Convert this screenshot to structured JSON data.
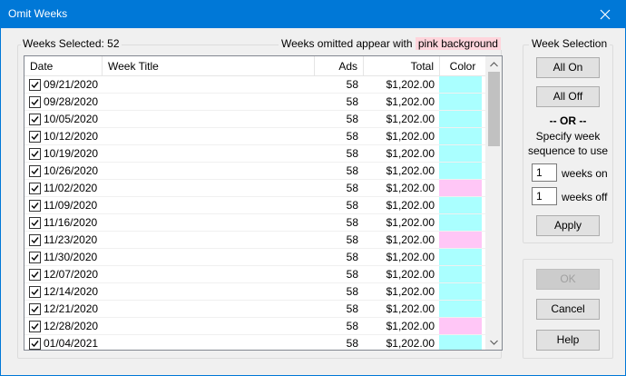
{
  "window": {
    "title": "Omit Weeks"
  },
  "summary": {
    "weeks_selected_label": "Weeks Selected: 52",
    "note_prefix": "Weeks omitted appear with",
    "note_highlight": "pink background"
  },
  "columns": [
    "Date",
    "Week Title",
    "Ads",
    "Total",
    "Color"
  ],
  "colors": {
    "included": "#aaffff",
    "omitted": "#ffc6f6",
    "title_bar": "#0078d7"
  },
  "rows": [
    {
      "date": "09/21/2020",
      "title": "",
      "ads": "58",
      "total": "$1,202.00",
      "checked": true,
      "omitted": false
    },
    {
      "date": "09/28/2020",
      "title": "",
      "ads": "58",
      "total": "$1,202.00",
      "checked": true,
      "omitted": false
    },
    {
      "date": "10/05/2020",
      "title": "",
      "ads": "58",
      "total": "$1,202.00",
      "checked": true,
      "omitted": false
    },
    {
      "date": "10/12/2020",
      "title": "",
      "ads": "58",
      "total": "$1,202.00",
      "checked": true,
      "omitted": false
    },
    {
      "date": "10/19/2020",
      "title": "",
      "ads": "58",
      "total": "$1,202.00",
      "checked": true,
      "omitted": false
    },
    {
      "date": "10/26/2020",
      "title": "",
      "ads": "58",
      "total": "$1,202.00",
      "checked": true,
      "omitted": false
    },
    {
      "date": "11/02/2020",
      "title": "",
      "ads": "58",
      "total": "$1,202.00",
      "checked": true,
      "omitted": true
    },
    {
      "date": "11/09/2020",
      "title": "",
      "ads": "58",
      "total": "$1,202.00",
      "checked": true,
      "omitted": false
    },
    {
      "date": "11/16/2020",
      "title": "",
      "ads": "58",
      "total": "$1,202.00",
      "checked": true,
      "omitted": false
    },
    {
      "date": "11/23/2020",
      "title": "",
      "ads": "58",
      "total": "$1,202.00",
      "checked": true,
      "omitted": true
    },
    {
      "date": "11/30/2020",
      "title": "",
      "ads": "58",
      "total": "$1,202.00",
      "checked": true,
      "omitted": false
    },
    {
      "date": "12/07/2020",
      "title": "",
      "ads": "58",
      "total": "$1,202.00",
      "checked": true,
      "omitted": false
    },
    {
      "date": "12/14/2020",
      "title": "",
      "ads": "58",
      "total": "$1,202.00",
      "checked": true,
      "omitted": false
    },
    {
      "date": "12/21/2020",
      "title": "",
      "ads": "58",
      "total": "$1,202.00",
      "checked": true,
      "omitted": false
    },
    {
      "date": "12/28/2020",
      "title": "",
      "ads": "58",
      "total": "$1,202.00",
      "checked": true,
      "omitted": true
    },
    {
      "date": "01/04/2021",
      "title": "",
      "ads": "58",
      "total": "$1,202.00",
      "checked": true,
      "omitted": false
    }
  ],
  "week_selection": {
    "group_label": "Week Selection",
    "all_on": "All On",
    "all_off": "All Off",
    "or_label": "-- OR --",
    "specify_text": "Specify week sequence to use",
    "weeks_on_value": "1",
    "weeks_on_label": "weeks on",
    "weeks_off_value": "1",
    "weeks_off_label": "weeks off",
    "apply": "Apply"
  },
  "actions": {
    "ok": "OK",
    "cancel": "Cancel",
    "help": "Help"
  },
  "icons": {
    "close": "close-icon",
    "check": "checkmark-icon",
    "scroll_up": "chevron-up-icon",
    "scroll_down": "chevron-down-icon"
  }
}
